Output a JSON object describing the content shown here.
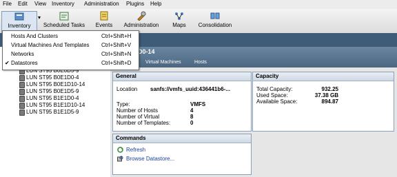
{
  "menubar": {
    "items": [
      "File",
      "Edit",
      "View",
      "Inventory",
      "Administration",
      "Plugins",
      "Help"
    ]
  },
  "toolbar": {
    "inventory": "Inventory",
    "scheduled_tasks": "Scheduled Tasks",
    "events": "Events",
    "administration": "Administration",
    "maps": "Maps",
    "consolidation": "Consolidation"
  },
  "dropdown": {
    "items": [
      {
        "label": "Hosts And Clusters",
        "shortcut": "Ctrl+Shift+H",
        "checked": false
      },
      {
        "label": "Virtual Machines And Templates",
        "shortcut": "Ctrl+Shift+V",
        "checked": false
      },
      {
        "label": "Networks",
        "shortcut": "Ctrl+Shift+N",
        "checked": false
      },
      {
        "label": "Datastores",
        "shortcut": "Ctrl+Shift+D",
        "checked": true
      }
    ],
    "check_glyph": "✔"
  },
  "header": {
    "title_fragment": "D0-14",
    "tabs": [
      "Virtual Machines",
      "Hosts"
    ]
  },
  "tree": {
    "items": [
      "LUN ST95 B0E0D5-9",
      "LUN ST95 B0E1D0-4",
      "LUN ST95 B0E1D10-14",
      "LUN ST95 B0E1D5-9",
      "LUN ST95 B1E1D0-4",
      "LUN ST95 B1E1D10-14",
      "LUN ST95 B1E1D5-9"
    ]
  },
  "general": {
    "title": "General",
    "location_label": "Location",
    "location_value": "sanfs://vmfs_uuid:436441b6-...",
    "type_label": "Type:",
    "type_value": "VMFS",
    "hosts_label": "Number of Hosts",
    "hosts_value": "4",
    "virtual_label": "Number of Virtual",
    "virtual_value": "8",
    "templates_label": "Number of Templates:",
    "templates_value": "0"
  },
  "capacity": {
    "title": "Capacity",
    "total_label": "Total Capacity:",
    "total_value": "932.25",
    "used_label": "Used Space:",
    "used_value": "37.38 GB",
    "avail_label": "Available Space:",
    "avail_value": "894.87"
  },
  "commands": {
    "title": "Commands",
    "refresh": "Refresh",
    "browse": "Browse Datastore..."
  },
  "colors": {
    "accent": "#3e5b78",
    "link": "#1a3fa0"
  }
}
